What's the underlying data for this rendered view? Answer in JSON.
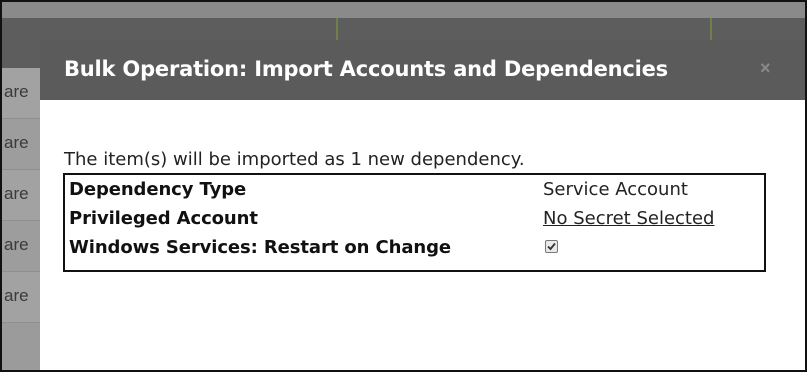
{
  "background": {
    "row_text": [
      "are",
      "are",
      "are",
      "are",
      "are"
    ]
  },
  "modal": {
    "title": "Bulk Operation: Import Accounts and Dependencies",
    "close_icon": "close-icon",
    "close_glyph": "×",
    "intro": "The item(s) will be imported as 1 new dependency.",
    "properties": [
      {
        "label": "Dependency Type",
        "value": "Service Account"
      },
      {
        "label": "Privileged Account",
        "value": "No Secret Selected"
      },
      {
        "label": "Windows Services: Restart on Change",
        "checked": true
      }
    ]
  },
  "colors": {
    "header_bg": "#5b5b5b",
    "overlay_bg": "#9b9b9b",
    "accent_divider": "#6f7f4a"
  }
}
